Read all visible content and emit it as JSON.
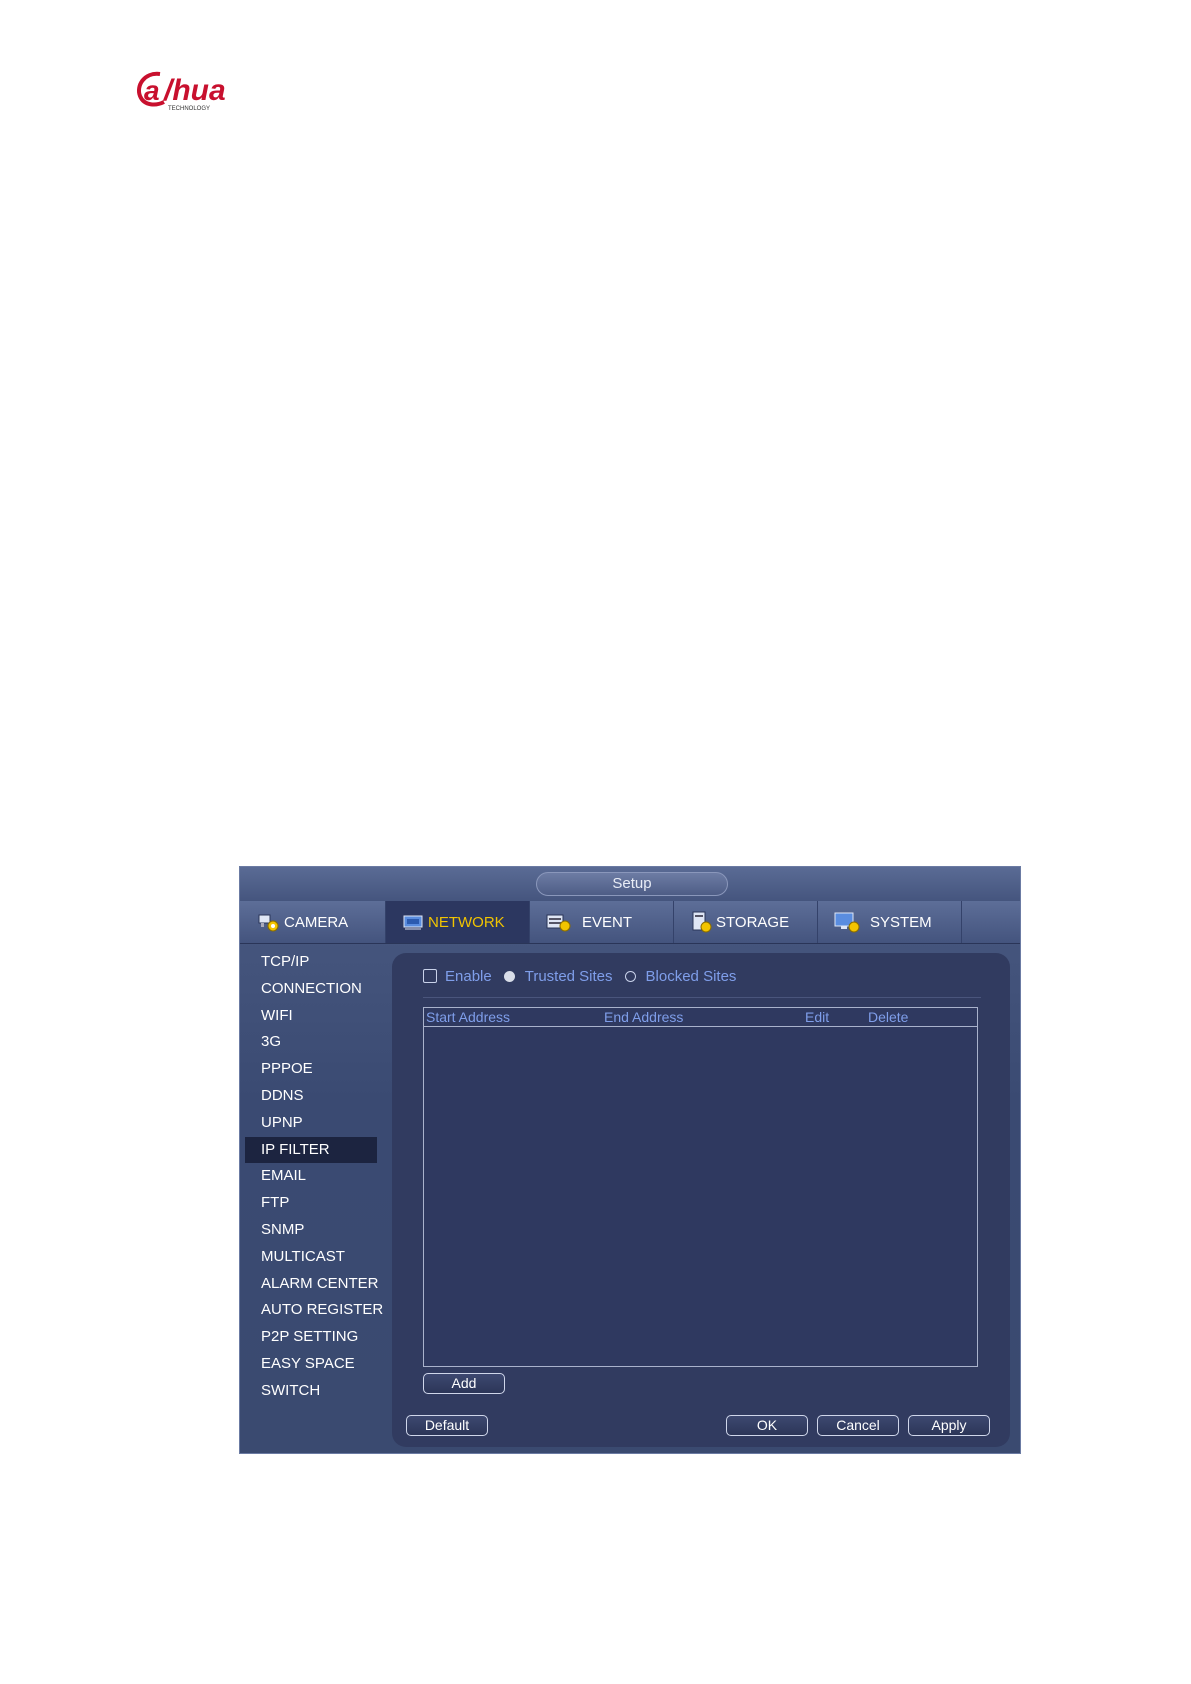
{
  "window": {
    "title": "Setup"
  },
  "tabs": [
    {
      "label": "CAMERA",
      "icon": "camera-gear-icon"
    },
    {
      "label": "NETWORK",
      "icon": "network-icon",
      "active": true
    },
    {
      "label": "EVENT",
      "icon": "event-icon"
    },
    {
      "label": "STORAGE",
      "icon": "storage-icon"
    },
    {
      "label": "SYSTEM",
      "icon": "system-monitor-icon"
    }
  ],
  "sidebar": {
    "items": [
      "TCP/IP",
      "CONNECTION",
      "WIFI",
      "3G",
      "PPPOE",
      "DDNS",
      "UPNP",
      "IP FILTER",
      "EMAIL",
      "FTP",
      "SNMP",
      "MULTICAST",
      "ALARM CENTER",
      "AUTO REGISTER",
      "P2P SETTING",
      "EASY SPACE",
      "SWITCH"
    ],
    "selected": "IP FILTER"
  },
  "options": {
    "enable_label": "Enable",
    "enable_checked": false,
    "trusted_label": "Trusted Sites",
    "blocked_label": "Blocked Sites",
    "selected_mode": "trusted"
  },
  "table": {
    "columns": [
      "Start Address",
      "End Address",
      "Edit",
      "Delete"
    ],
    "rows": []
  },
  "buttons": {
    "add": "Add",
    "default": "Default",
    "ok": "OK",
    "cancel": "Cancel",
    "apply": "Apply"
  },
  "colors": {
    "accent": "#f2c400",
    "link_text": "#7f9eea",
    "panel": "#313b60"
  }
}
